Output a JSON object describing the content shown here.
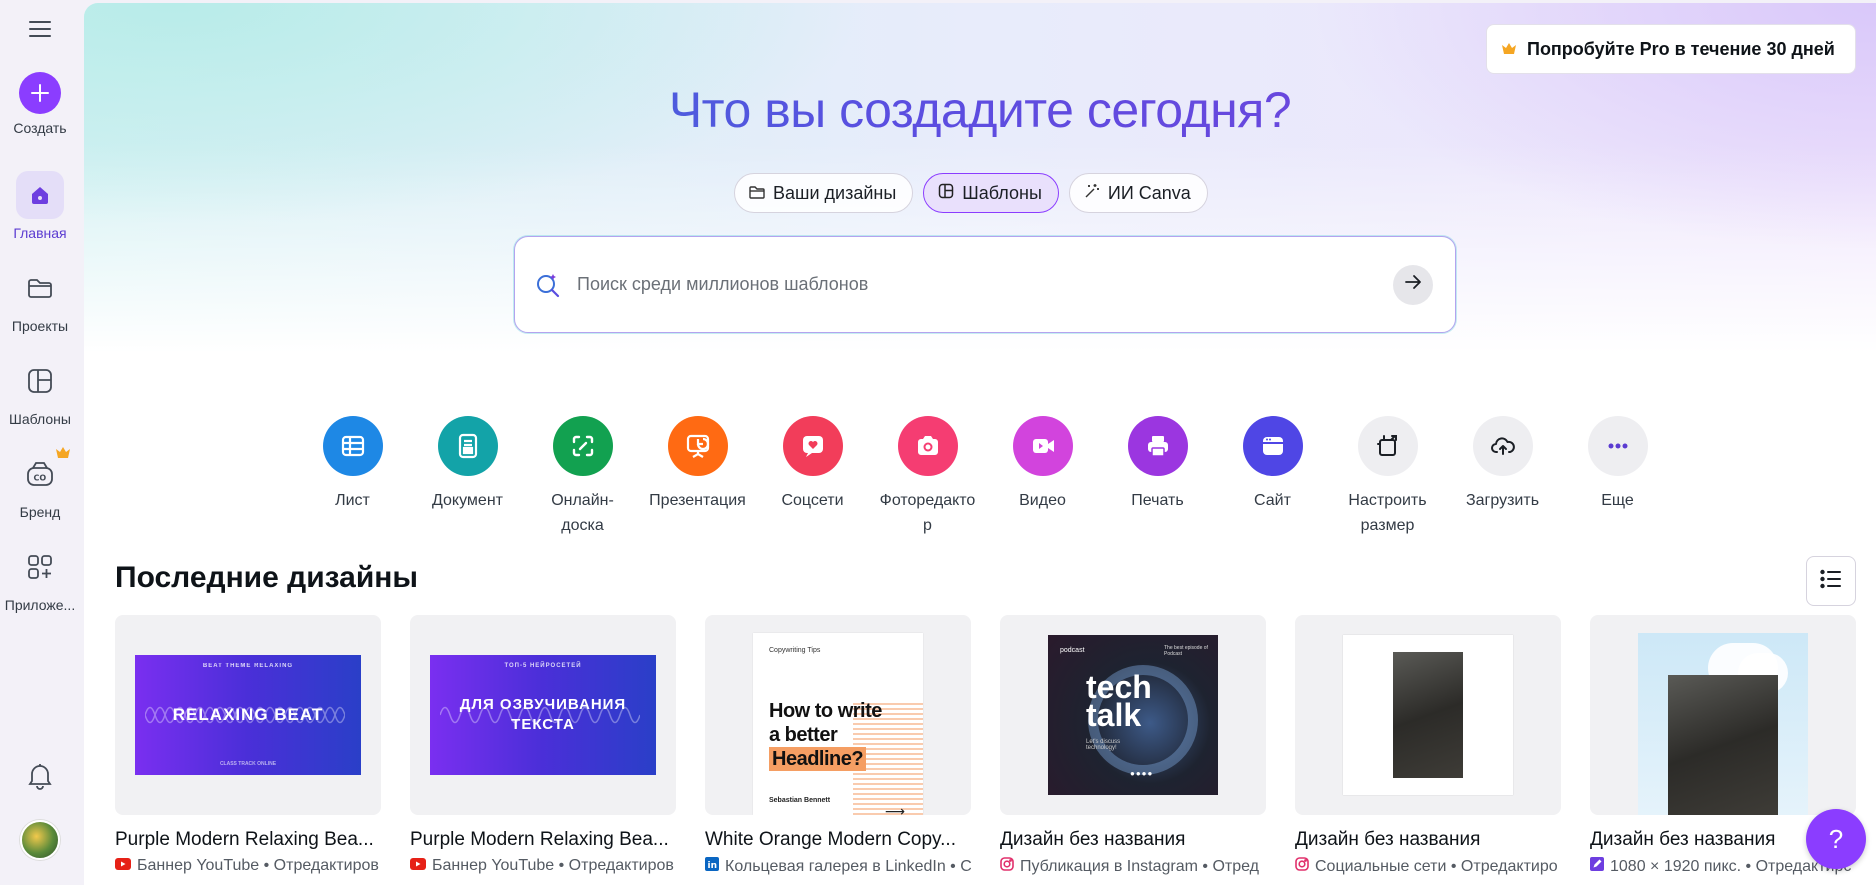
{
  "sidebar": {
    "items": [
      {
        "label": "Создать"
      },
      {
        "label": "Главная"
      },
      {
        "label": "Проекты"
      },
      {
        "label": "Шаблоны"
      },
      {
        "label": "Бренд"
      },
      {
        "label": "Приложе..."
      }
    ]
  },
  "header": {
    "pro_label": "Попробуйте Pro в течение 30 дней",
    "title": "Что вы создадите сегодня?"
  },
  "tabs": [
    {
      "label": "Ваши дизайны"
    },
    {
      "label": "Шаблоны"
    },
    {
      "label": "ИИ Canva"
    }
  ],
  "search": {
    "placeholder": "Поиск среди миллионов шаблонов"
  },
  "categories": [
    {
      "label": "Лист",
      "color": "#1e88e5"
    },
    {
      "label": "Документ",
      "color": "#13a3a8"
    },
    {
      "label": "Онлайн-доска",
      "color": "#12a150"
    },
    {
      "label": "Презентация",
      "color": "#ff6a13"
    },
    {
      "label": "Соцсети",
      "color": "#f23d5a"
    },
    {
      "label": "Фоторедактор",
      "color": "#f53d72"
    },
    {
      "label": "Видео",
      "color": "#d244dd"
    },
    {
      "label": "Печать",
      "color": "#9b36e0"
    },
    {
      "label": "Сайт",
      "color": "#4f46e5"
    },
    {
      "label": "Настроить размер",
      "color": "#eeeef1"
    },
    {
      "label": "Загрузить",
      "color": "#eeeef1"
    },
    {
      "label": "Еще",
      "color": "#eeeef1"
    }
  ],
  "recent": {
    "title": "Последние дизайны",
    "cards": [
      {
        "title": "Purple Modern Relaxing Bea...",
        "subtitle": "Баннер YouTube • Отредактиров",
        "thumb_top": "BEAT THEME RELAXING",
        "thumb_text": "RELAXING BEAT",
        "thumb_bottom": "CLASS TRACK ONLINE"
      },
      {
        "title": "Purple Modern Relaxing Bea...",
        "subtitle": "Баннер YouTube • Отредактиров",
        "thumb_top": "ТОП-5 НЕЙРОСЕТЕЙ",
        "thumb_text": "ДЛЯ ОЗВУЧИВАНИЯ ТЕКСТА"
      },
      {
        "title": "White Orange Modern Copy...",
        "subtitle": "Кольцевая галерея в LinkedIn • С",
        "thumb_kicker": "Copywriting Tips",
        "thumb_line1": "How to write",
        "thumb_line2": "a better",
        "thumb_highlight": "Headline?",
        "thumb_author": "Sebastian Bennett"
      },
      {
        "title": "Дизайн без названия",
        "subtitle": "Публикация в Instagram • Отред",
        "thumb_tag": "podcast",
        "thumb_side": "The best episode of Podcast",
        "thumb_big1": "tech",
        "thumb_big2": "talk",
        "thumb_small": "Let's discuss technology!"
      },
      {
        "title": "Дизайн без названия",
        "subtitle": "Социальные сети • Отредактиро"
      },
      {
        "title": "Дизайн без названия",
        "subtitle": "1080 × 1920 пикс. • Отредактирс"
      }
    ]
  },
  "help": {
    "label": "?"
  },
  "colors": {
    "accent": "#8b3dff",
    "youtube": "#e62117",
    "linkedin": "#0a66c2"
  }
}
